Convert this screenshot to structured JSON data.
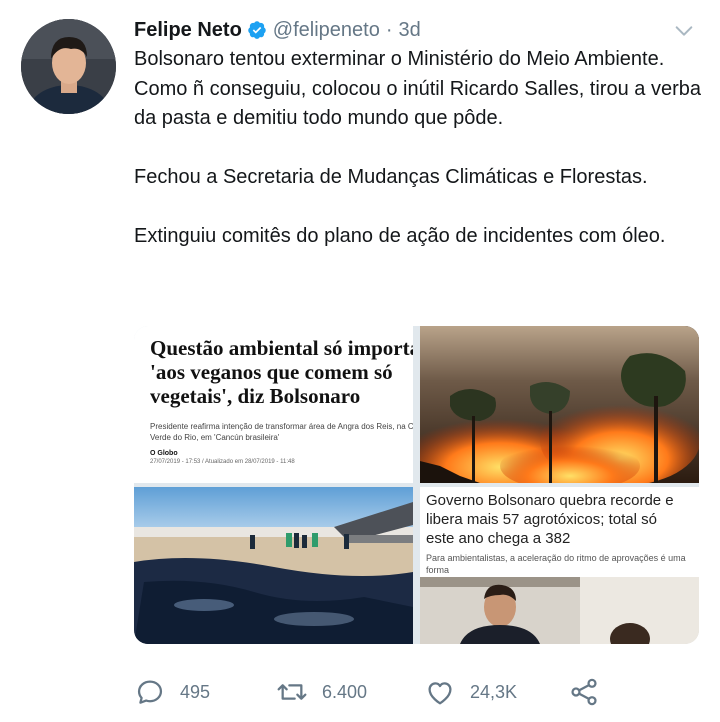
{
  "tweet": {
    "author_name": "Felipe Neto",
    "handle": "@felipeneto",
    "separator": "·",
    "time": "3d",
    "paragraphs": [
      "Bolsonaro tentou exterminar o Ministério do Meio Ambiente. Como ñ conseguiu, colocou o inútil Ricardo Salles, tirou a verba da pasta e demitiu todo mundo que pôde.",
      "Fechou a Secretaria de Mudanças Climáticas e Florestas.",
      "Extinguiu comitês do plano de ação de incidentes com óleo."
    ]
  },
  "media": {
    "newspaper": {
      "headline": "Questão ambiental só importa\n'aos veganos que comem só\nvegetais', diz Bolsonaro",
      "subheadline": "Presidente reafirma intenção de transformar área de Angra dos Reis, na Costa\nVerde do Rio, em 'Cancún brasileira'",
      "source": "O Globo",
      "date": "27/07/2019 - 17:53 / Atualizado em 28/07/2019 - 11:48"
    },
    "gov_article": {
      "headline": "Governo Bolsonaro quebra recorde e\nlibera mais 57 agrotóxicos; total só\neste ano chega a 382",
      "subheadline": "Para ambientalistas, a aceleração do ritmo de aprovações é uma forma\nde o governo colocar em prática itens do \"Pacote do Veneno\""
    }
  },
  "actions": {
    "reply_count": "495",
    "retweet_count": "6.400",
    "like_count": "24,3K"
  },
  "colors": {
    "text": "#14171a",
    "secondary": "#657786",
    "verified": "#1da1f2"
  },
  "icons": [
    "verified-badge-icon",
    "chevron-down-icon",
    "reply-icon",
    "retweet-icon",
    "like-icon",
    "share-icon"
  ]
}
